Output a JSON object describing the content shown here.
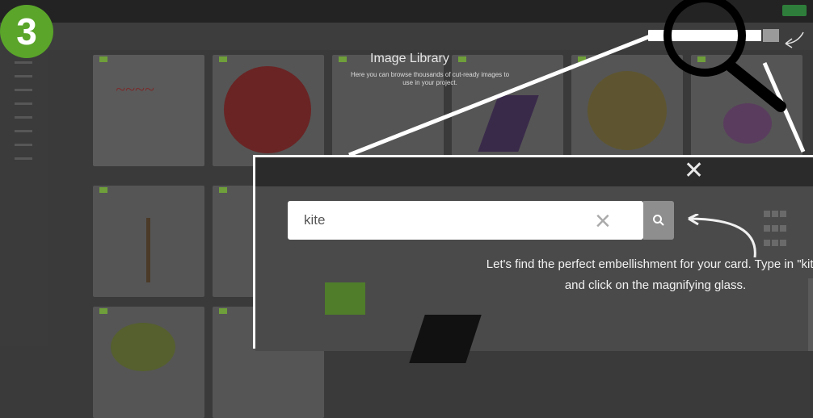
{
  "step": {
    "number": "3"
  },
  "library": {
    "title": "Image Library",
    "description": "Here you can browse thousands of cut-ready images to use in your project."
  },
  "search": {
    "value": "kite",
    "button_icon": "search-icon",
    "clear_icon": "close-icon"
  },
  "hint": {
    "text": "Let's find the perfect embellishment for your card. Type in \"kite\" and click on the magnifying glass."
  },
  "icons": {
    "close": "close-icon",
    "grid": "grid-icon",
    "magnifier": "magnifier-icon"
  },
  "colors": {
    "badge": "#5aa52a",
    "accent_tag": "#6f9f3a"
  }
}
